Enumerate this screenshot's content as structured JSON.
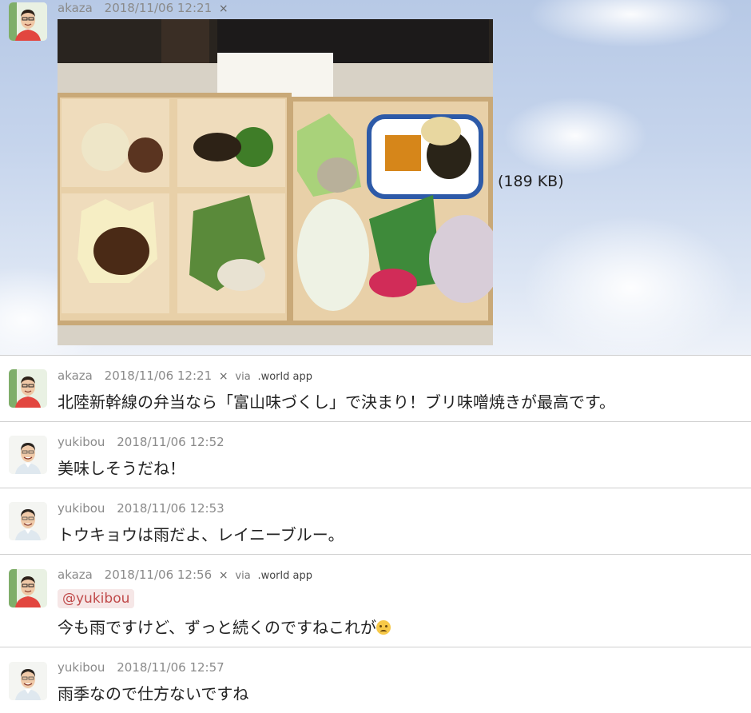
{
  "posts": [
    {
      "user": "akaza",
      "timestamp": "2018/11/06 12:21",
      "close": "×",
      "attachment_size": "(189 KB)"
    },
    {
      "user": "akaza",
      "timestamp": "2018/11/06 12:21",
      "close": "×",
      "via": "via",
      "app": ".world app",
      "text": "北陸新幹線の弁当なら「富山味づくし」で決まり！ブリ味噌焼きが最高です。"
    },
    {
      "user": "yukibou",
      "timestamp": "2018/11/06 12:52",
      "text": "美味しそうだね！"
    },
    {
      "user": "yukibou",
      "timestamp": "2018/11/06 12:53",
      "text": "トウキョウは雨だよ、レイニーブルー。"
    },
    {
      "user": "akaza",
      "timestamp": "2018/11/06 12:56",
      "close": "×",
      "via": "via",
      "app": ".world app",
      "mention": "@yukibou",
      "text": "今も雨ですけど、ずっと続くのですねこれが"
    },
    {
      "user": "yukibou",
      "timestamp": "2018/11/06 12:57",
      "text": "雨季なので仕方ないですね"
    }
  ],
  "icons": {
    "avatar_akaza": "avatar-akaza",
    "avatar_yukibou": "avatar-yukibou",
    "emoji": "crying-face-icon"
  },
  "colors": {
    "mention_text": "#c04a4a",
    "mention_bg": "#f6e7e7",
    "divider": "#cfcfcf"
  }
}
